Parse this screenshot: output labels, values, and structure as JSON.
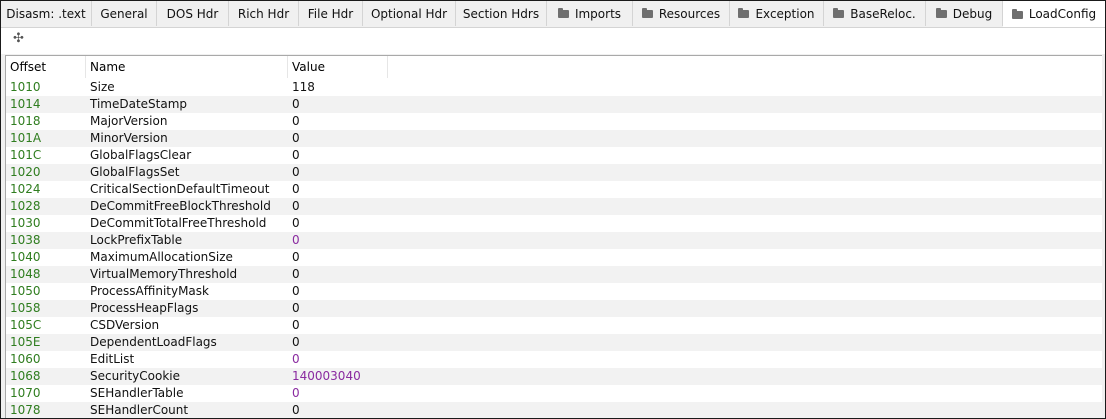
{
  "tabs": [
    {
      "label": "Disasm: .text",
      "folder": false,
      "active": false
    },
    {
      "label": "General",
      "folder": false,
      "active": false
    },
    {
      "label": "DOS Hdr",
      "folder": false,
      "active": false
    },
    {
      "label": "Rich Hdr",
      "folder": false,
      "active": false
    },
    {
      "label": "File Hdr",
      "folder": false,
      "active": false
    },
    {
      "label": "Optional Hdr",
      "folder": false,
      "active": false
    },
    {
      "label": "Section Hdrs",
      "folder": false,
      "active": false
    },
    {
      "label": "Imports",
      "folder": true,
      "active": false
    },
    {
      "label": "Resources",
      "folder": true,
      "active": false
    },
    {
      "label": "Exception",
      "folder": true,
      "active": false
    },
    {
      "label": "BaseReloc.",
      "folder": true,
      "active": false
    },
    {
      "label": "Debug",
      "folder": true,
      "active": false
    },
    {
      "label": "LoadConfig",
      "folder": true,
      "active": true
    }
  ],
  "toolbar": {
    "move_icon": "move-icon"
  },
  "columns": {
    "offset": "Offset",
    "name": "Name",
    "value": "Value"
  },
  "rows": [
    {
      "offset": "1010",
      "name": "Size",
      "value": "118",
      "kind": "plain"
    },
    {
      "offset": "1014",
      "name": "TimeDateStamp",
      "value": "0",
      "kind": "plain"
    },
    {
      "offset": "1018",
      "name": "MajorVersion",
      "value": "0",
      "kind": "plain"
    },
    {
      "offset": "101A",
      "name": "MinorVersion",
      "value": "0",
      "kind": "plain"
    },
    {
      "offset": "101C",
      "name": "GlobalFlagsClear",
      "value": "0",
      "kind": "plain"
    },
    {
      "offset": "1020",
      "name": "GlobalFlagsSet",
      "value": "0",
      "kind": "plain"
    },
    {
      "offset": "1024",
      "name": "CriticalSectionDefaultTimeout",
      "value": "0",
      "kind": "plain"
    },
    {
      "offset": "1028",
      "name": "DeCommitFreeBlockThreshold",
      "value": "0",
      "kind": "plain"
    },
    {
      "offset": "1030",
      "name": "DeCommitTotalFreeThreshold",
      "value": "0",
      "kind": "plain"
    },
    {
      "offset": "1038",
      "name": "LockPrefixTable",
      "value": "0",
      "kind": "addr"
    },
    {
      "offset": "1040",
      "name": "MaximumAllocationSize",
      "value": "0",
      "kind": "plain"
    },
    {
      "offset": "1048",
      "name": "VirtualMemoryThreshold",
      "value": "0",
      "kind": "plain"
    },
    {
      "offset": "1050",
      "name": "ProcessAffinityMask",
      "value": "0",
      "kind": "plain"
    },
    {
      "offset": "1058",
      "name": "ProcessHeapFlags",
      "value": "0",
      "kind": "plain"
    },
    {
      "offset": "105C",
      "name": "CSDVersion",
      "value": "0",
      "kind": "plain"
    },
    {
      "offset": "105E",
      "name": "DependentLoadFlags",
      "value": "0",
      "kind": "plain"
    },
    {
      "offset": "1060",
      "name": "EditList",
      "value": "0",
      "kind": "addr"
    },
    {
      "offset": "1068",
      "name": "SecurityCookie",
      "value": "140003040",
      "kind": "addr"
    },
    {
      "offset": "1070",
      "name": "SEHandlerTable",
      "value": "0",
      "kind": "addr"
    },
    {
      "offset": "1078",
      "name": "SEHandlerCount",
      "value": "0",
      "kind": "plain"
    }
  ],
  "colors": {
    "offset": "#2f7d1f",
    "address": "#8a2aa0",
    "text": "#111111"
  }
}
